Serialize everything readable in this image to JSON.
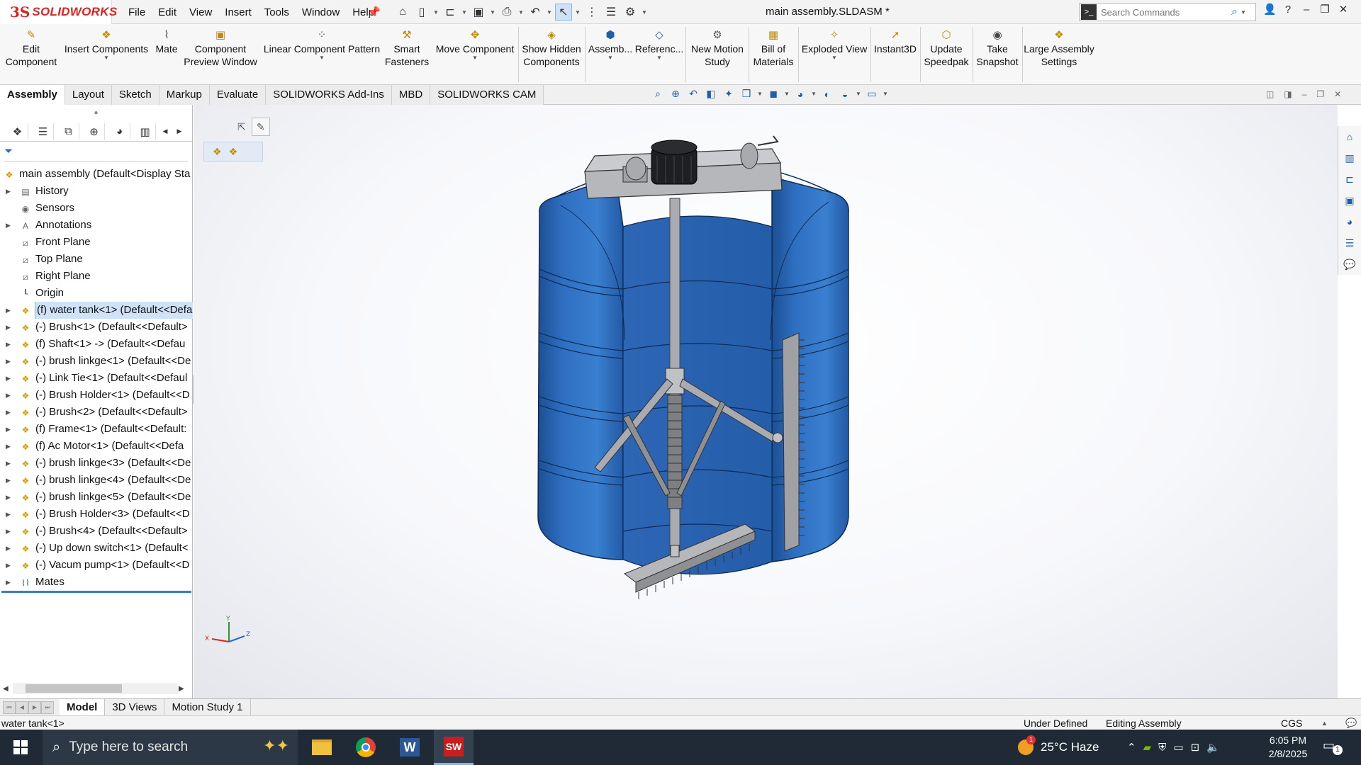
{
  "app": {
    "logo_ds": "3S",
    "logo_text": "SOLIDWORKS",
    "document_title": "main assembly.SLDASM *"
  },
  "menu": [
    "File",
    "Edit",
    "View",
    "Insert",
    "Tools",
    "Window",
    "Help"
  ],
  "search": {
    "placeholder": "Search Commands"
  },
  "commands": {
    "edit_component": "Edit\nComponent",
    "insert_components": "Insert Components",
    "mate": "Mate",
    "component_preview": "Component\nPreview Window",
    "linear_pattern": "Linear Component Pattern",
    "smart_fasteners": "Smart\nFasteners",
    "move_component": "Move Component",
    "show_hidden": "Show Hidden\nComponents",
    "assembly": "Assemb...",
    "reference": "Referenc...",
    "new_motion": "New Motion\nStudy",
    "bom": "Bill of\nMaterials",
    "exploded": "Exploded View",
    "instant3d": "Instant3D",
    "speedpak": "Update\nSpeedpak",
    "snapshot": "Take\nSnapshot",
    "large_assembly": "Large Assembly\nSettings"
  },
  "tabs": [
    "Assembly",
    "Layout",
    "Sketch",
    "Markup",
    "Evaluate",
    "SOLIDWORKS Add-Ins",
    "MBD",
    "SOLIDWORKS CAM"
  ],
  "tree": {
    "root": "main assembly  (Default<Display Sta",
    "history": "History",
    "sensors": "Sensors",
    "annotations": "Annotations",
    "front_plane": "Front Plane",
    "top_plane": "Top Plane",
    "right_plane": "Right Plane",
    "origin": "Origin",
    "components": [
      "(f) water tank<1> (Default<<Defa",
      "(-) Brush<1> (Default<<Default>",
      "(f) Shaft<1> -> (Default<<Defau",
      "(-) brush linkge<1> (Default<<De",
      "(-) Link Tie<1> (Default<<Defaul",
      "(-) Brush Holder<1> (Default<<D",
      "(-) Brush<2> (Default<<Default>",
      "(f) Frame<1> (Default<<Default:",
      "(f) Ac Motor<1> (Default<<Defa",
      "(-) brush linkge<3> (Default<<De",
      "(-) brush linkge<4> (Default<<De",
      "(-) brush linkge<5> (Default<<De",
      "(-) Brush Holder<3> (Default<<D",
      "(-) Brush<4> (Default<<Default>",
      "(-) Up down switch<1> (Default<",
      "(-) Vacum pump<1> (Default<<D"
    ],
    "mates": "Mates"
  },
  "model_tabs": [
    "Model",
    "3D Views",
    "Motion Study 1"
  ],
  "status": {
    "selection": "water tank<1>",
    "definition": "Under Defined",
    "mode": "Editing Assembly",
    "units": "CGS"
  },
  "triad": {
    "x": "X",
    "y": "Y",
    "z": "Z"
  },
  "taskbar": {
    "search_placeholder": "Type here to search",
    "weather": "25°C  Haze",
    "weather_badge": "1",
    "time": "6:05 PM",
    "date": "2/8/2025",
    "sw_icon": "SW",
    "notification_count": "1"
  },
  "colors": {
    "tank": "#2f6fc2",
    "tank_dark": "#1f4f94",
    "steel": "#a9abb0",
    "accent": "#2a6ebb"
  }
}
